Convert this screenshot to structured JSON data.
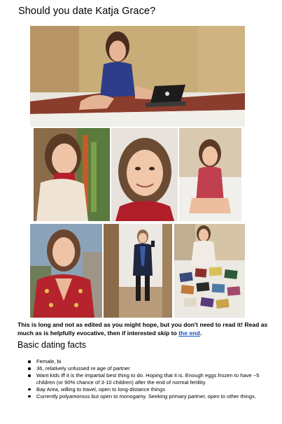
{
  "title": "Should you date Katja Grace?",
  "intro": {
    "text": "This is long and not as edited as you might hope, but you don't need to read it! Read as much as is helpfully evocative, then if interested skip to ",
    "link_text": "the end",
    "after": "."
  },
  "basic_heading": "Basic dating facts",
  "facts": [
    "Female, bi",
    "36, relatively unfussed re age of partner",
    "Want kids iff it is the impartial best thing to do. Hoping that it is. Enough eggs frozen to have ~5 children (or 90% chance of 3-10 children) after the end of normal fertility.",
    "Bay Area, willing to travel, open to long-distance things",
    "Currently polyamorous but open to monogamy. Seeking primary partner, open to other things."
  ],
  "colors": {
    "link": "#1155cc"
  }
}
